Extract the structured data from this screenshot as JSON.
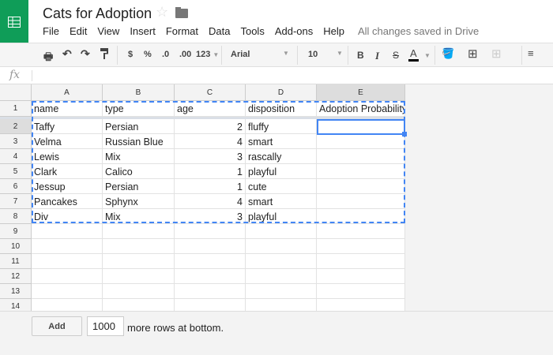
{
  "doc": {
    "title": "Cats for Adoption",
    "saved_status": "All changes saved in Drive"
  },
  "menu": [
    "File",
    "Edit",
    "View",
    "Insert",
    "Format",
    "Data",
    "Tools",
    "Add-ons",
    "Help"
  ],
  "toolbar": {
    "currency": "$",
    "percent": "%",
    "dec_less": ".0",
    "dec_more": ".00",
    "number_format": "123",
    "font": "Arial",
    "font_size": "10",
    "bold": "B",
    "italic": "I",
    "strike": "S",
    "text_color": "A"
  },
  "formula": {
    "label": "fx",
    "value": ""
  },
  "columns": [
    "A",
    "B",
    "C",
    "D",
    "E"
  ],
  "row_numbers": [
    "1",
    "2",
    "3",
    "4",
    "5",
    "6",
    "7",
    "8",
    "9",
    "10",
    "11",
    "12",
    "13",
    "14"
  ],
  "rows": [
    [
      "name",
      "type",
      "age",
      "disposition",
      "Adoption Probability"
    ],
    [
      "Taffy",
      "Persian",
      "2",
      "fluffy",
      ""
    ],
    [
      "Velma",
      "Russian Blue",
      "4",
      "smart",
      ""
    ],
    [
      "Lewis",
      "Mix",
      "3",
      "rascally",
      ""
    ],
    [
      "Clark",
      "Calico",
      "1",
      "playful",
      ""
    ],
    [
      "Jessup",
      "Persian",
      "1",
      "cute",
      ""
    ],
    [
      "Pancakes",
      "Sphynx",
      "4",
      "smart",
      ""
    ],
    [
      "Div",
      "Mix",
      "3",
      "playful",
      ""
    ]
  ],
  "footer": {
    "add_label": "Add",
    "rows_value": "1000",
    "more_rows_text": "more rows at bottom."
  }
}
